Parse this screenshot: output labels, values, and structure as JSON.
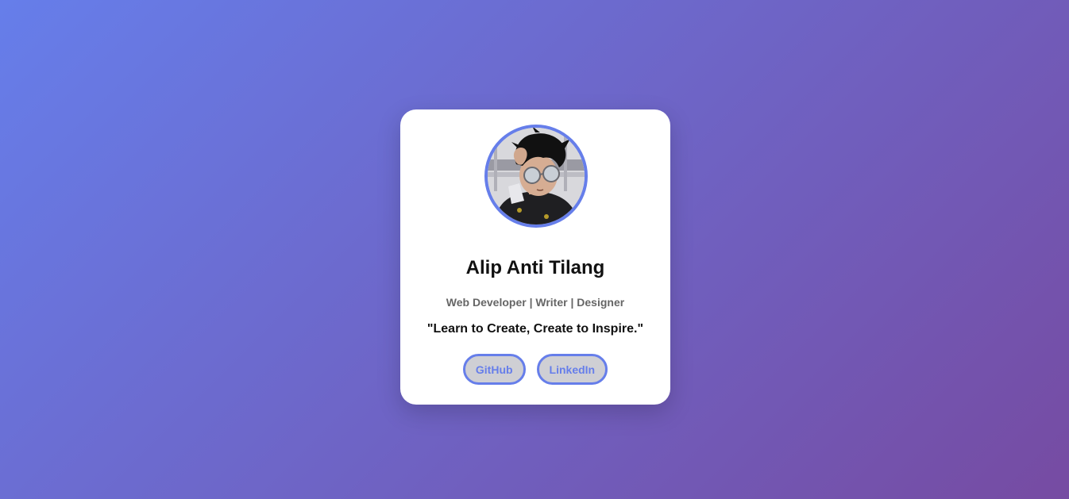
{
  "profile": {
    "name": "Alip Anti Tilang",
    "roles": "Web Developer | Writer | Designer",
    "quote": "\"Learn to Create, Create to Inspire.\"",
    "avatar_icon": "avatar-illustration"
  },
  "links": [
    {
      "label": "GitHub"
    },
    {
      "label": "LinkedIn"
    }
  ],
  "colors": {
    "gradient_start": "#667eea",
    "gradient_end": "#764ba2",
    "accent": "#667eea",
    "card_bg": "#ffffff"
  }
}
